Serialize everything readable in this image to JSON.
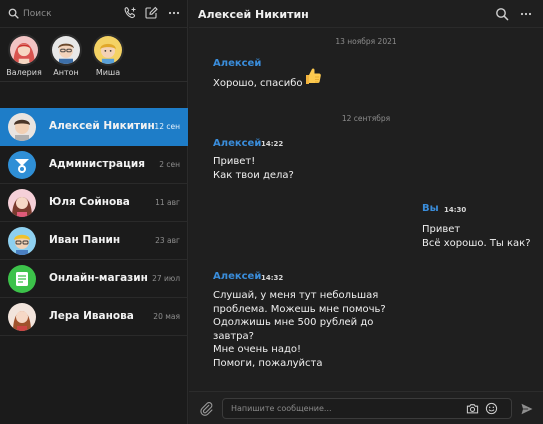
{
  "sidebar": {
    "search": {
      "placeholder": "Поиск"
    },
    "stories": [
      {
        "name": "Валерия",
        "icon": "avatar-valeria"
      },
      {
        "name": "Антон",
        "icon": "avatar-anton"
      },
      {
        "name": "Миша",
        "icon": "avatar-misha"
      }
    ],
    "chats": [
      {
        "name": "Алексей Никитин",
        "date": "12 сен",
        "active": true
      },
      {
        "name": "Администрация",
        "date": "2 сен"
      },
      {
        "name": "Юля Сойнова",
        "date": "11 авг"
      },
      {
        "name": "Иван Панин",
        "date": "23 авг"
      },
      {
        "name": "Онлайн-магазин",
        "date": "27 июл"
      },
      {
        "name": "Лера Иванова",
        "date": "20 мая"
      }
    ]
  },
  "header": {
    "title": "Алексей Никитин"
  },
  "messages": {
    "sep1": "13 ноября 2021",
    "m1": {
      "sender": "Алексей",
      "text": "Хорошо, спасибо",
      "emoji": "thumbs-up"
    },
    "sep2": "12 сентября",
    "m2": {
      "sender": "Алексей",
      "time": "14:22",
      "text": "Привет!\nКак твои дела?"
    },
    "m3": {
      "sender": "Вы",
      "time": "14:30",
      "text": "Привет\nВсё хорошо. Ты как?"
    },
    "m4": {
      "sender": "Алексей",
      "time": "14:32",
      "text": "Слушай, у меня тут небольшая\nпроблема. Можешь мне помочь?\nОдолжишь мне 500 рублей до\nзавтра?\nМне очень надо!\nПомоги, пожалуйста"
    }
  },
  "composer": {
    "placeholder": "Напишите сообщение..."
  },
  "colors": {
    "accent": "#1e7dc8",
    "sender": "#3a8ddb",
    "background": "#1e1e1e"
  }
}
